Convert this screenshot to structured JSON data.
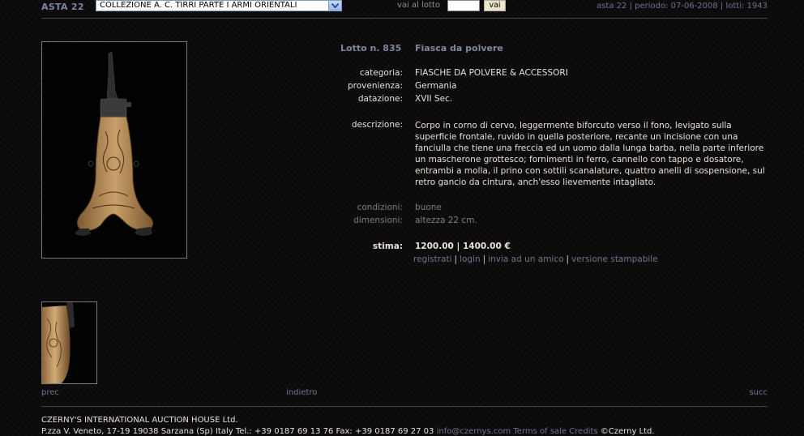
{
  "topbar": {
    "asta_label": "ASTA 22",
    "collection_select": "COLLEZIONE A. C. TIRRI PARTE I ARMI ORIENTALI",
    "vai_al_lotto_label": "vai al lotto",
    "lotto_input_value": "",
    "vai_button": "vai",
    "info": "asta 22 | periodo: 07-06-2008 | lotti: 1943"
  },
  "lot": {
    "number_label": "Lotto n. 835",
    "title": "Fiasca da polvere",
    "fields": [
      {
        "label": "categoria:",
        "value": "FIASCHE DA POLVERE & ACCESSORI"
      },
      {
        "label": "provenienza:",
        "value": "Germania"
      },
      {
        "label": "datazione:",
        "value": "XVII Sec."
      }
    ],
    "descrizione_label": "descrizione:",
    "descrizione": "Corpo in corno di cervo, leggermente biforcuto verso il fono, levigato sulla superficie frontale, ruvido in quella posteriore, recante un incisione con una fanciulla che tiene una freccia ed un uomo dalla lunga barba, nella parte inferiore un mascherone grottesco; fornimenti in ferro, cannello con tappo e dosatore, entrambi a molla, il prino con sottili scanalature, quattro anelli di sospensione, sul retro gancio da cintura, anch'esso lievemente intagliato.",
    "condizioni_label": "condizioni:",
    "condizioni": "buone",
    "dimensioni_label": "dimensioni:",
    "dimensioni": "altezza 22 cm.",
    "stima_label": "stima:",
    "stima": "1200.00 | 1400.00 €",
    "links": [
      "registrati",
      "login",
      "invia ad un amico",
      "versione stampabile"
    ]
  },
  "nav": {
    "prev": "prec",
    "back": "indietro",
    "next": "succ"
  },
  "footer": {
    "company": "CZERNY'S INTERNATIONAL AUCTION HOUSE Ltd.",
    "address": "P.zza V. Veneto, 17-19 19038 Sarzana (Sp) Italy   Tel.: +39 0187 69 13 76 Fax: +39 0187 69 27 03",
    "email": "info@czernys.com",
    "terms": "Terms of sale",
    "credits": "Credits",
    "copyright": "©Czerny Ltd."
  },
  "colors": {
    "accent": "#7f86a0",
    "background": "#0b0909",
    "rule": "#3b4256"
  }
}
